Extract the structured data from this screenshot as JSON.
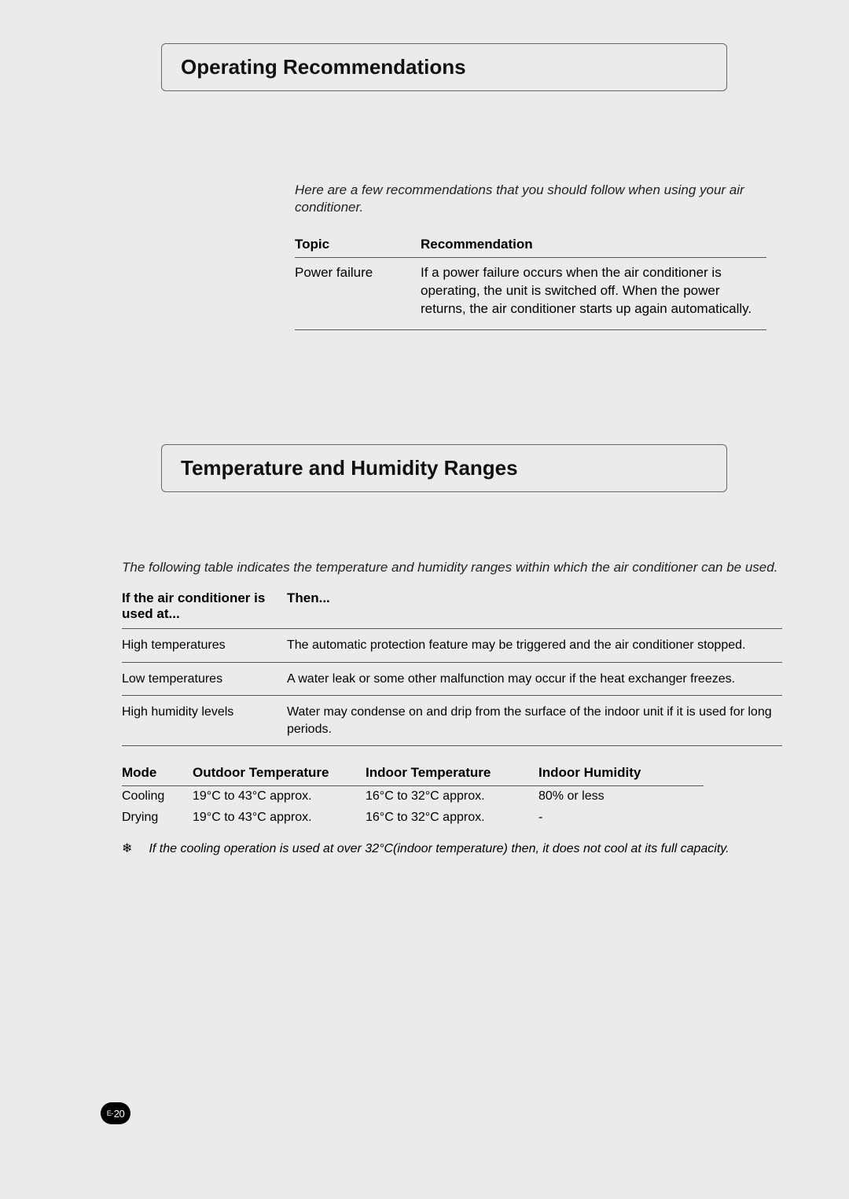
{
  "section1": {
    "title": "Operating Recommendations",
    "intro": "Here are a few recommendations that you should follow when using your air conditioner.",
    "headers": {
      "topic": "Topic",
      "recommendation": "Recommendation"
    },
    "rows": [
      {
        "topic": "Power failure",
        "recommendation": "If a power failure occurs when the air conditioner is operating, the unit is switched off. When the power returns, the air conditioner starts up again automatically."
      }
    ]
  },
  "section2": {
    "title": "Temperature and Humidity Ranges",
    "intro": "The following table indicates the temperature and humidity ranges within which the air conditioner can be used.",
    "cond_headers": {
      "condition": "If the air conditioner is used at...",
      "then": "Then..."
    },
    "conditions": [
      {
        "condition": "High temperatures",
        "then": "The automatic protection feature may be triggered and the air conditioner stopped."
      },
      {
        "condition": "Low temperatures",
        "then": "A water leak or some other malfunction may occur if the heat exchanger freezes."
      },
      {
        "condition": "High humidity levels",
        "then": "Water may condense on and drip from the surface of the indoor unit if it is used for long periods."
      }
    ],
    "mode_headers": {
      "mode": "Mode",
      "outdoor": "Outdoor Temperature",
      "indoor": "Indoor Temperature",
      "humidity": "Indoor Humidity"
    },
    "modes": [
      {
        "mode": "Cooling",
        "outdoor": "19°C to 43°C approx.",
        "indoor": "16°C to 32°C approx.",
        "humidity": "80% or less"
      },
      {
        "mode": "Drying",
        "outdoor": "19°C to 43°C approx.",
        "indoor": "16°C to 32°C approx.",
        "humidity": "-"
      }
    ],
    "footnote_symbol": "❄",
    "footnote": "If the cooling operation is used at over 32°C(indoor temperature) then, it does not cool at its full capacity."
  },
  "page_number": {
    "prefix": "E-",
    "num": "20"
  }
}
